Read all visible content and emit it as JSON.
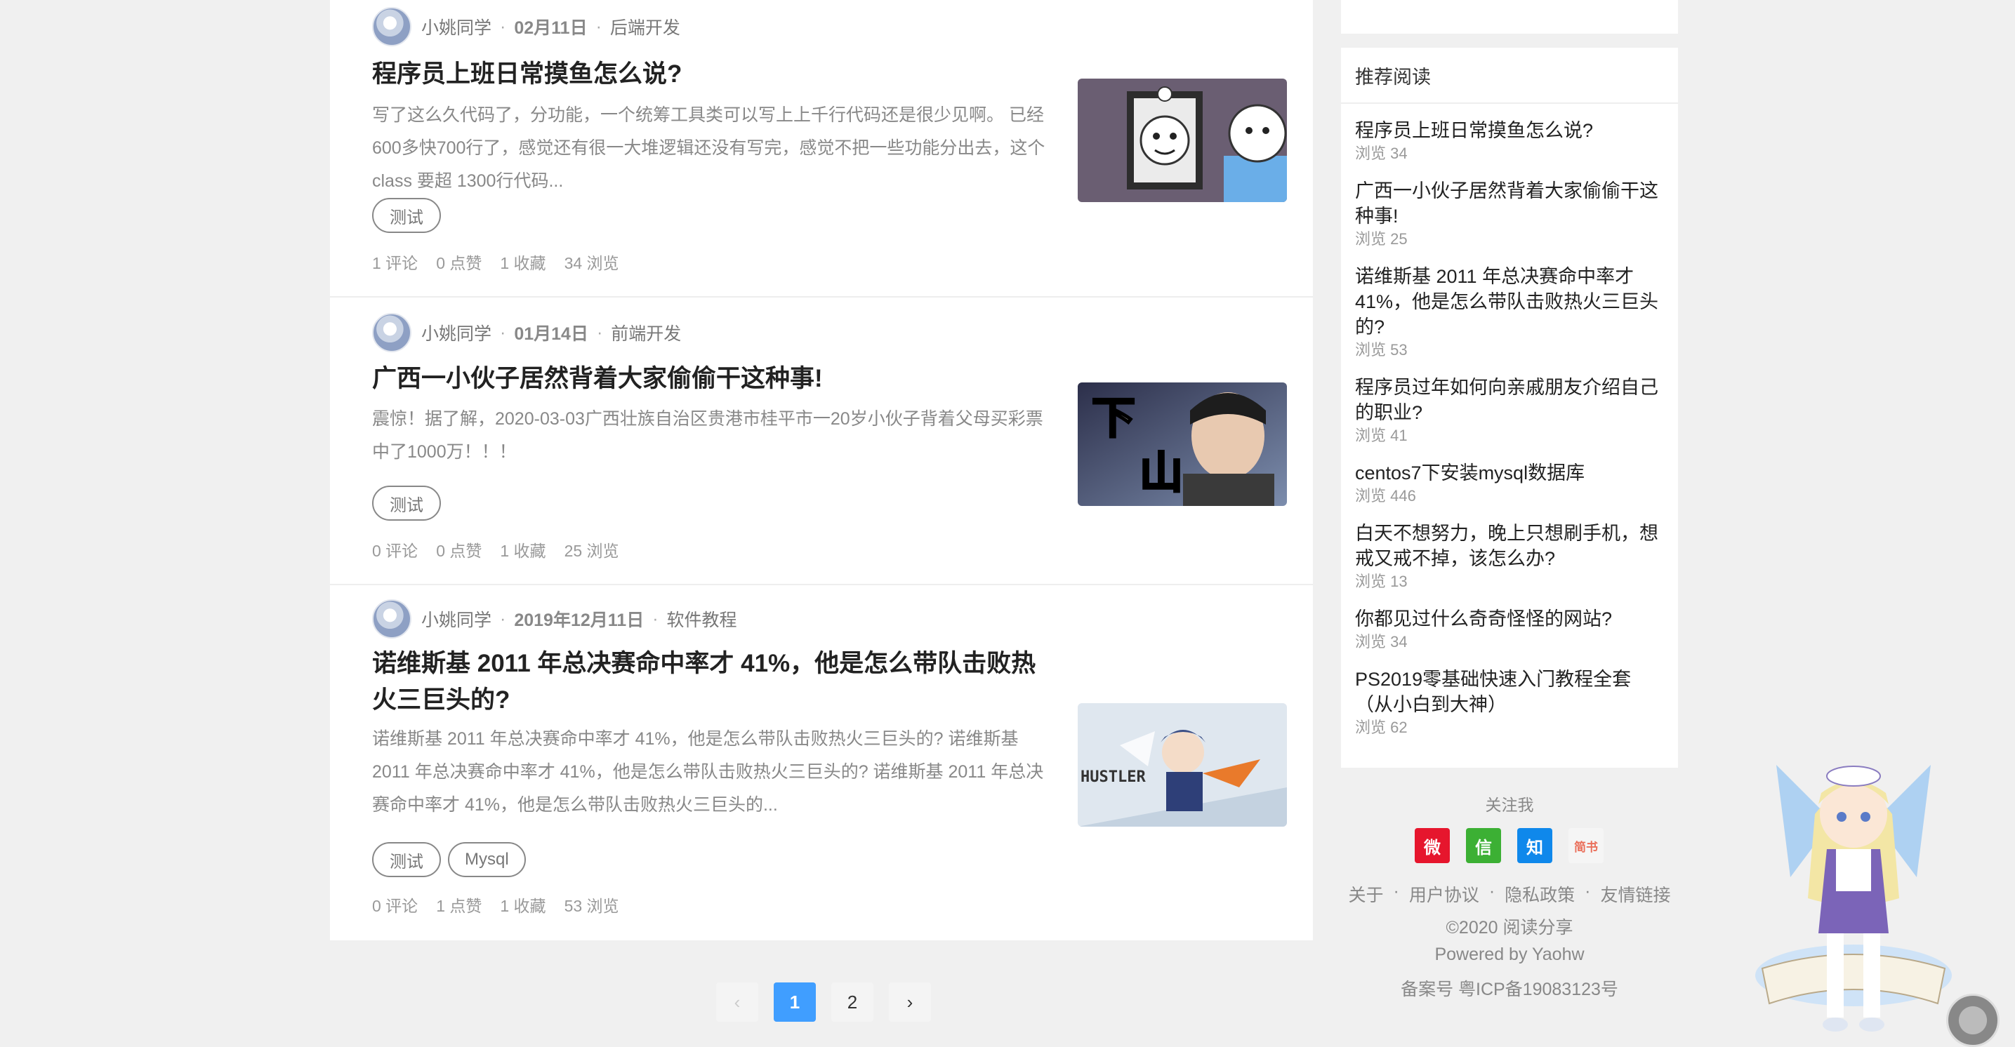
{
  "articles": [
    {
      "author": "小姚同学",
      "date": "02月11日",
      "category": "后端开发",
      "title": "程序员上班日常摸鱼怎么说?",
      "excerpt": "写了这么久代码了，分功能，一个统筹工具类可以写上上千行代码还是很少见啊。 已经600多快700行了，感觉还有很一大堆逻辑还没有写完，感觉不把一些功能分出去，这个class 要超 1300行代码...",
      "tags": [
        "测试"
      ],
      "comments": "1 评论",
      "likes": "0 点赞",
      "favorites": "1 收藏",
      "views": "34 浏览"
    },
    {
      "author": "小姚同学",
      "date": "01月14日",
      "category": "前端开发",
      "title": "广西一小伙子居然背着大家偷偷干这种事!",
      "excerpt": "震惊！据了解，2020-03-03广西壮族自治区贵港市桂平市一20岁小伙子背着父母买彩票中了1000万！！！",
      "tags": [
        "测试"
      ],
      "comments": "0 评论",
      "likes": "0 点赞",
      "favorites": "1 收藏",
      "views": "25 浏览",
      "thumb_text": [
        "下",
        "山"
      ]
    },
    {
      "author": "小姚同学",
      "date": "2019年12月11日",
      "category": "软件教程",
      "title": "诺维斯基 2011 年总决赛命中率才 41%，他是怎么带队击败热火三巨头的?",
      "excerpt": "诺维斯基 2011 年总决赛命中率才 41%，他是怎么带队击败热火三巨头的? 诺维斯基 2011 年总决赛命中率才 41%，他是怎么带队击败热火三巨头的? 诺维斯基 2011 年总决赛命中率才 41%，他是怎么带队击败热火三巨头的...",
      "tags": [
        "测试",
        "Mysql"
      ],
      "comments": "0 评论",
      "likes": "1 点赞",
      "favorites": "1 收藏",
      "views": "53 浏览",
      "thumb_text": [
        "HUSTLER"
      ]
    }
  ],
  "meta_separator": "·",
  "pagination": {
    "prev": "‹",
    "pages": [
      "1",
      "2"
    ],
    "active": "1",
    "next": "›"
  },
  "sidebar": {
    "heading": "推荐阅读",
    "items": [
      {
        "title": "程序员上班日常摸鱼怎么说?",
        "views": "浏览 34"
      },
      {
        "title": "广西一小伙子居然背着大家偷偷干这种事!",
        "views": "浏览 25"
      },
      {
        "title": "诺维斯基 2011 年总决赛命中率才 41%，他是怎么带队击败热火三巨头的?",
        "views": "浏览 53"
      },
      {
        "title": "程序员过年如何向亲戚朋友介绍自己的职业?",
        "views": "浏览 41"
      },
      {
        "title": "centos7下安装mysql数据库",
        "views": "浏览 446"
      },
      {
        "title": "白天不想努力，晚上只想刷手机，想戒又戒不掉，该怎么办?",
        "views": "浏览 13"
      },
      {
        "title": "你都见过什么奇奇怪怪的网站?",
        "views": "浏览 34"
      },
      {
        "title": "PS2019零基础快速入门教程全套（从小白到大神）",
        "views": "浏览 62"
      }
    ]
  },
  "follow": {
    "label": "关注我",
    "icons": [
      {
        "name": "weibo-icon",
        "glyph": "微",
        "color": "#e6162d"
      },
      {
        "name": "wechat-icon",
        "glyph": "信",
        "color": "#3cb034"
      },
      {
        "name": "zhihu-icon",
        "glyph": "知",
        "color": "#0f88eb"
      },
      {
        "name": "jianshu-icon",
        "glyph": "简书",
        "color": "#f5f5f5",
        "text_color": "#ea6f5a"
      }
    ]
  },
  "footer": {
    "links": [
      "关于",
      "用户协议",
      "隐私政策",
      "友情链接"
    ],
    "copyright": "©2020 阅读分享",
    "powered": "Powered by Yaohw",
    "icp": "备案号 粤ICP备19083123号"
  }
}
